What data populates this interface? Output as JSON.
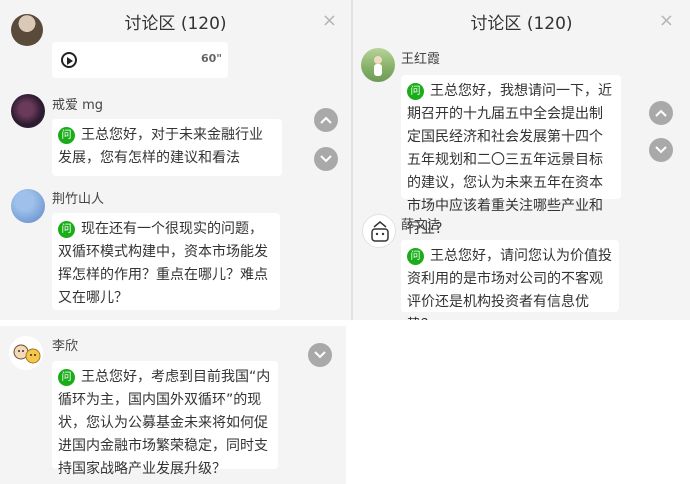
{
  "header": {
    "title": "讨论区 (120)",
    "close": "×"
  },
  "badge": "问",
  "panel1": {
    "audio": {
      "duration": "60\""
    },
    "posts": [
      {
        "user": "戒爱 mg",
        "question": "王总您好，对于未来金融行业发展，您有怎样的建议和看法"
      },
      {
        "user": "荆竹山人",
        "question": "现在还有一个很现实的问题，双循环模式构建中，资本市场能发挥怎样的作用？重点在哪儿？难点又在哪儿？"
      }
    ]
  },
  "panel2": {
    "posts": [
      {
        "user": "王红霞",
        "question": "王总您好，我想请问一下，近期召开的十九届五中全会提出制定国民经济和社会发展第十四个五年规划和二〇三五年远景目标的建议，您认为未来五年在资本市场中应该着重关注哪些产业和行业？"
      },
      {
        "user": "薛文洁",
        "question": "王总您好，请问您认为价值投资利用的是市场对公司的不客观评价还是机构投资者有信息优势？"
      }
    ]
  },
  "panel3": {
    "posts": [
      {
        "user": "李欣",
        "question": "王总您好，考虑到目前我国“内循环为主，国内国外双循环”的现状，您认为公募基金未来将如何促进国内金融市场繁荣稳定，同时支持国家战略产业发展升级？"
      }
    ]
  },
  "colors": {
    "badge_green": "#1aad19",
    "nav_grey": "#a9a9a9",
    "panel_bg": "#f4f4f4"
  }
}
